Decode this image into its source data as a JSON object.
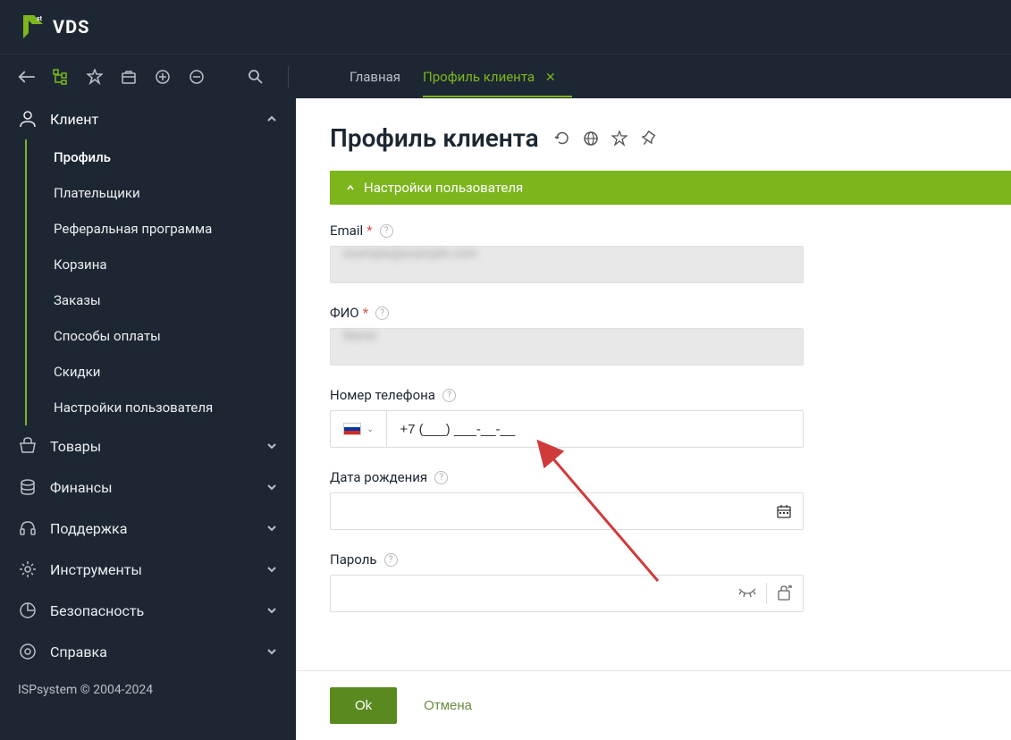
{
  "logo": {
    "text": "VDS",
    "sup": "st"
  },
  "tabs": {
    "main": "Главная",
    "profile": "Профиль клиента"
  },
  "sidebar": {
    "client": "Клиент",
    "sub": {
      "profile": "Профиль",
      "payers": "Плательщики",
      "referral": "Реферальная программа",
      "cart": "Корзина",
      "orders": "Заказы",
      "payment_methods": "Способы оплаты",
      "discounts": "Скидки",
      "user_settings": "Настройки пользователя"
    },
    "goods": "Товары",
    "finance": "Финансы",
    "support": "Поддержка",
    "tools": "Инструменты",
    "security": "Безопасность",
    "help": "Справка"
  },
  "footer_copy": "ISPsystem © 2004-2024",
  "page": {
    "title": "Профиль клиента",
    "panel_title": "Настройки пользователя"
  },
  "form": {
    "email_label": "Email",
    "email_value": "example@example.com",
    "fio_label": "ФИО",
    "fio_value": "Name",
    "phone_label": "Номер телефона",
    "phone_mask": "+7 (___) ___-__-__",
    "dob_label": "Дата рождения",
    "password_label": "Пароль"
  },
  "buttons": {
    "ok": "Ok",
    "cancel": "Отмена"
  }
}
